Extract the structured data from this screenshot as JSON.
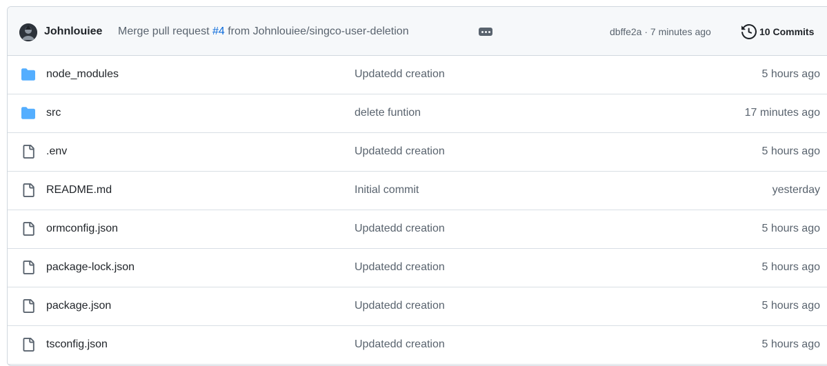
{
  "commit_header": {
    "author": "Johnlouiee",
    "message_prefix": "Merge pull request",
    "pr_number": "#4",
    "message_suffix": "from Johnlouiee/singco-user-deletion",
    "meta": "dbffe2a · 7 minutes ago",
    "commits_label": "10 Commits"
  },
  "files": [
    {
      "type": "folder",
      "name": "node_modules",
      "message": "Updatedd creation",
      "age": "5 hours ago"
    },
    {
      "type": "folder",
      "name": "src",
      "message": "delete funtion",
      "age": "17 minutes ago"
    },
    {
      "type": "file",
      "name": ".env",
      "message": "Updatedd creation",
      "age": "5 hours ago"
    },
    {
      "type": "file",
      "name": "README.md",
      "message": "Initial commit",
      "age": "yesterday"
    },
    {
      "type": "file",
      "name": "ormconfig.json",
      "message": "Updatedd creation",
      "age": "5 hours ago"
    },
    {
      "type": "file",
      "name": "package-lock.json",
      "message": "Updatedd creation",
      "age": "5 hours ago"
    },
    {
      "type": "file",
      "name": "package.json",
      "message": "Updatedd creation",
      "age": "5 hours ago"
    },
    {
      "type": "file",
      "name": "tsconfig.json",
      "message": "Updatedd creation",
      "age": "5 hours ago"
    }
  ],
  "colors": {
    "folder": "#54aeff",
    "link": "#0969da",
    "muted": "#59636e",
    "header_bg": "#f6f8fa"
  }
}
